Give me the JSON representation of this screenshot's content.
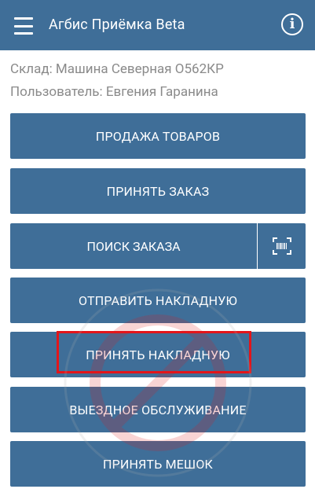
{
  "appbar": {
    "title": "Агбис Приёмка Beta",
    "menu_icon": "hamburger-menu-icon",
    "info_icon": "info-icon",
    "info_glyph": "i"
  },
  "info": {
    "warehouse": "Склад: Машина Северная О562КР",
    "user": "Пользователь: Евгения Гаранина"
  },
  "buttons": {
    "sell_goods": "ПРОДАЖА ТОВАРОВ",
    "accept_order": "ПРИНЯТЬ ЗАКАЗ",
    "search_order": "ПОИСК ЗАКАЗА",
    "send_invoice": "ОТПРАВИТЬ НАКЛАДНУЮ",
    "accept_invoice": "ПРИНЯТЬ НАКЛАДНУЮ",
    "onsite_service": "ВЫЕЗДНОЕ ОБСЛУЖИВАНИЕ",
    "accept_bag": "ПРИНЯТЬ МЕШОК"
  },
  "colors": {
    "primary": "#3f6e98",
    "highlight": "#e3151a",
    "text_muted": "#8a8a8a"
  }
}
